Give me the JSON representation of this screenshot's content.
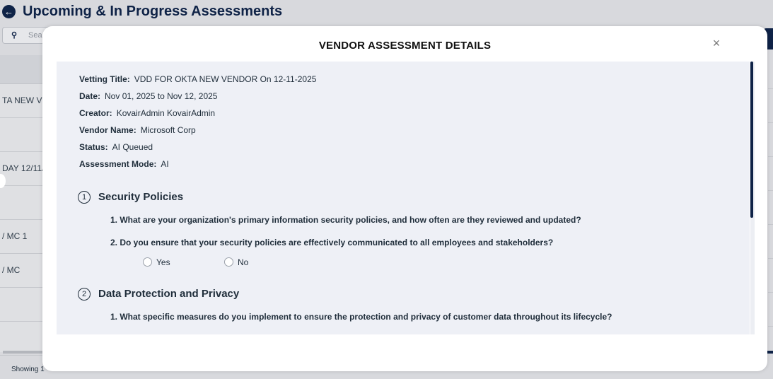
{
  "page": {
    "title": "Upcoming & In Progress Assessments",
    "search_placeholder": "Sea",
    "table_rows": [
      "TA NEW V",
      "",
      "DAY 12/11/",
      "",
      "/ MC 1",
      "/ MC",
      "",
      ""
    ],
    "footer_text": "Showing 1"
  },
  "modal": {
    "title": "VENDOR ASSESSMENT DETAILS",
    "close_label": "×",
    "details": [
      {
        "label": "Vetting Title:",
        "value": "VDD FOR OKTA NEW VENDOR On 12-11-2025"
      },
      {
        "label": "Date:",
        "value": "Nov 01, 2025 to Nov 12, 2025"
      },
      {
        "label": "Creator:",
        "value": "KovairAdmin KovairAdmin"
      },
      {
        "label": "Vendor Name:",
        "value": "Microsoft Corp"
      },
      {
        "label": "Status:",
        "value": "AI Queued"
      },
      {
        "label": "Assessment Mode:",
        "value": "AI"
      }
    ],
    "sections": [
      {
        "number": "1",
        "title": "Security Policies",
        "questions": [
          "1. What are your organization's primary information security policies, and how often are they reviewed and updated?",
          "2. Do you ensure that your security policies are effectively communicated to all employees and stakeholders?"
        ],
        "options": [
          "Yes",
          "No"
        ]
      },
      {
        "number": "2",
        "title": "Data Protection and Privacy",
        "questions": [
          "1. What specific measures do you implement to ensure the protection and privacy of customer data throughout its lifecycle?"
        ]
      }
    ]
  },
  "colors": {
    "navy": "#0f2347",
    "content_bg": "#eef0f6",
    "overlay_bg": "#d8d9dd"
  },
  "icons": {
    "back": "arrow-left-circle-icon",
    "search": "magnifier-icon",
    "close": "close-x-icon"
  }
}
